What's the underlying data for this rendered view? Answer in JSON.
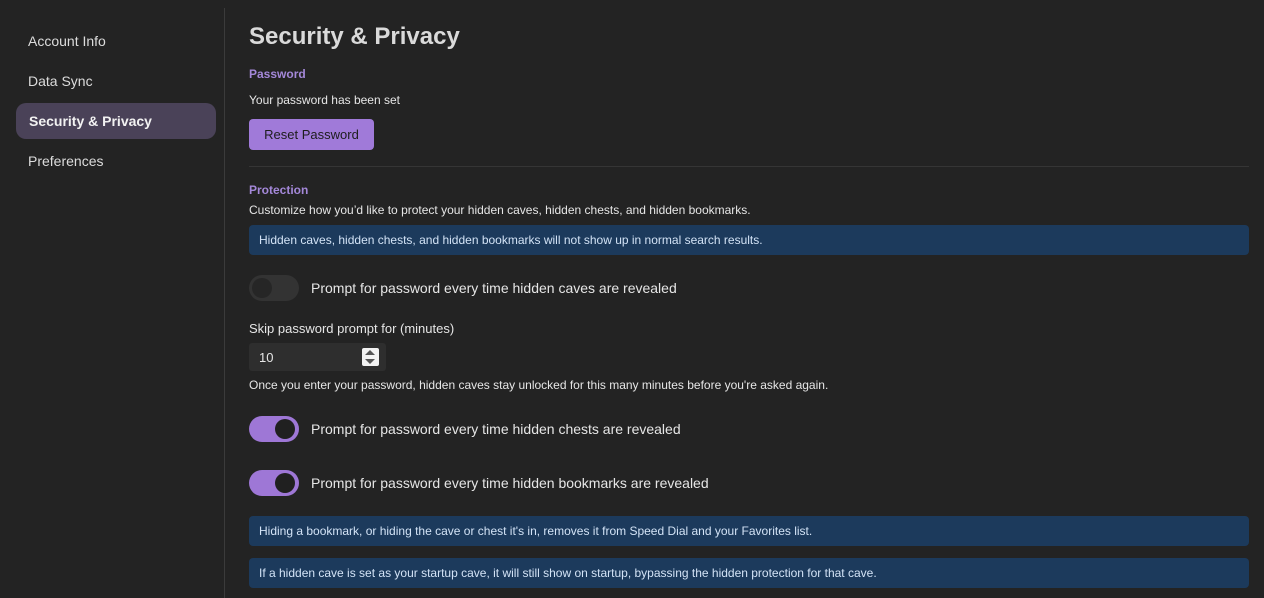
{
  "sidebar": {
    "items": [
      {
        "label": "Account Info",
        "active": false
      },
      {
        "label": "Data Sync",
        "active": false
      },
      {
        "label": "Security & Privacy",
        "active": true
      },
      {
        "label": "Preferences",
        "active": false
      }
    ]
  },
  "main": {
    "title": "Security & Privacy",
    "password": {
      "section_label": "Password",
      "status_text": "Your password has been set",
      "reset_button_label": "Reset Password"
    },
    "protection": {
      "section_label": "Protection",
      "description": "Customize how you’d like to protect your hidden caves, hidden chests, and hidden bookmarks.",
      "info_search": "Hidden caves, hidden chests, and hidden bookmarks will not show up in normal search results.",
      "toggles": {
        "caves": {
          "label": "Prompt for password every time hidden caves are revealed",
          "enabled": false
        },
        "chests": {
          "label": "Prompt for password every time hidden chests are revealed",
          "enabled": true
        },
        "bookmarks": {
          "label": "Prompt for password every time hidden bookmarks are revealed",
          "enabled": true
        }
      },
      "skip_prompt": {
        "label": "Skip password prompt for (minutes)",
        "value": "10",
        "help_text": "Once you enter your password, hidden caves stay unlocked for this many minutes before you're asked again."
      },
      "info_speed_dial": "Hiding a bookmark, or hiding the cave or chest it's in, removes it from Speed Dial and your Favorites list.",
      "info_startup": "If a hidden cave is set as your startup cave, it will still show on startup, bypassing the hidden protection for that cave."
    }
  },
  "colors": {
    "background": "#232323",
    "accent": "#a07ad9",
    "section_label": "#a488d9",
    "info_box": "#1c3a5c",
    "active_nav": "#4a4258"
  }
}
